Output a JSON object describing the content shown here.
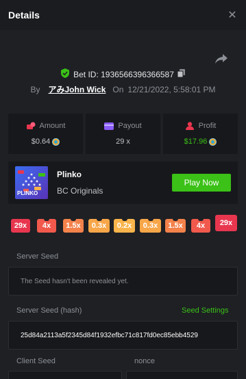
{
  "header": {
    "title": "Details"
  },
  "bet": {
    "id_label": "Bet ID:",
    "id_value": "1936566396366587",
    "by_label": "By",
    "username": "アみJohn Wick",
    "on_label": "On",
    "datetime": "12/21/2022, 5:58:01 PM"
  },
  "stats": {
    "amount": {
      "label": "Amount",
      "value": "$0.64"
    },
    "payout": {
      "label": "Payout",
      "value": "29 x"
    },
    "profit": {
      "label": "Profit",
      "value": "$17.96"
    }
  },
  "game": {
    "name": "Plinko",
    "provider": "BC Originals",
    "thumb_label": "PLINKO",
    "play_label": "Play Now"
  },
  "multipliers": [
    {
      "label": "29x",
      "color": "#e8364f"
    },
    {
      "label": "4x",
      "color": "#f0594c"
    },
    {
      "label": "1.5x",
      "color": "#f3824b"
    },
    {
      "label": "0.3x",
      "color": "#f7a649"
    },
    {
      "label": "0.2x",
      "color": "#f9b44b"
    },
    {
      "label": "0.3x",
      "color": "#f7a649"
    },
    {
      "label": "1.5x",
      "color": "#f3824b"
    },
    {
      "label": "4x",
      "color": "#f0594c"
    },
    {
      "label": "29x",
      "color": "#e8364f"
    }
  ],
  "server_seed": {
    "label": "Server Seed",
    "value": "The Seed hasn't been revealed yet."
  },
  "server_seed_hash": {
    "label": "Server Seed (hash)",
    "settings_label": "Seed Settings",
    "value": "25d84a2113a5f2345d84f1932efbc71c817fd0ec85ebb4529"
  },
  "client_seed": {
    "label": "Client Seed"
  },
  "nonce": {
    "label": "nonce"
  },
  "colors": {
    "accent": "#3bc117",
    "background": "#1e2024",
    "panel": "#17181b"
  }
}
